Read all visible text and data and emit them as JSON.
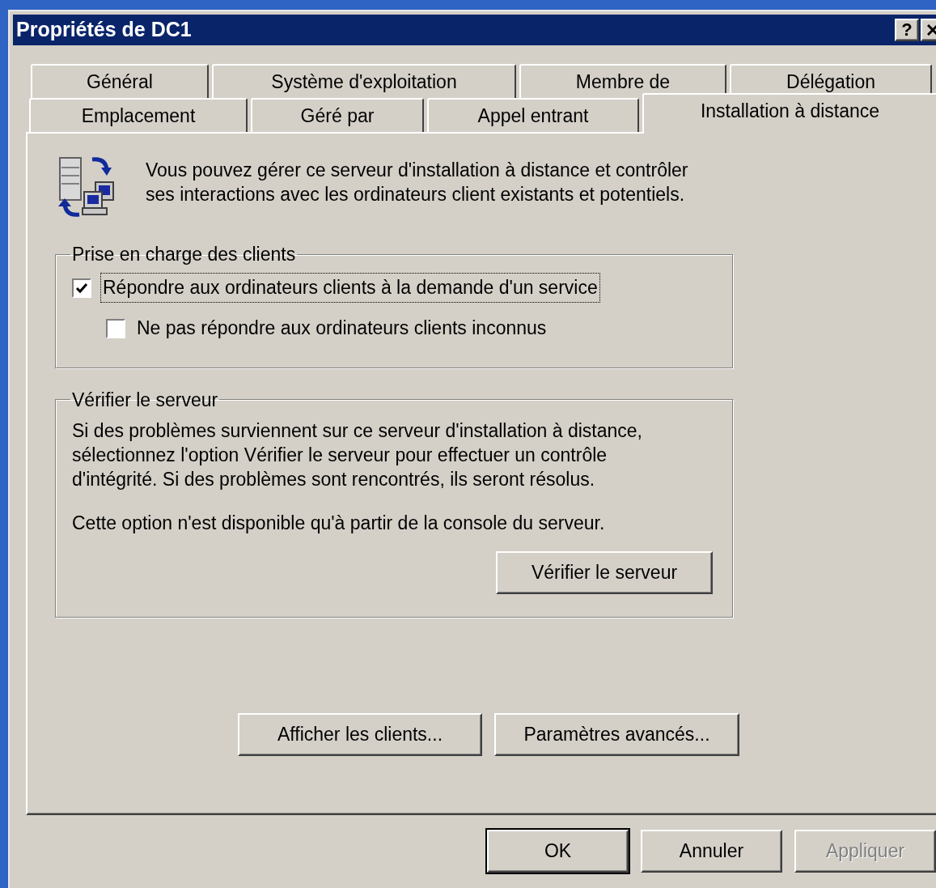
{
  "window": {
    "title": "Propriétés de DC1",
    "title_buttons": [
      {
        "kind": "help",
        "label": "?"
      },
      {
        "kind": "close"
      }
    ]
  },
  "tabs": [
    [
      {
        "label": "Général",
        "selected": false
      },
      {
        "label": "Système d'exploitation",
        "selected": false
      },
      {
        "label": "Membre de",
        "selected": false
      },
      {
        "label": "Délégation",
        "selected": false
      }
    ],
    [
      {
        "label": "Emplacement",
        "selected": false
      },
      {
        "label": "Géré par",
        "selected": false
      },
      {
        "label": "Appel entrant",
        "selected": false
      },
      {
        "label": "Installation à distance",
        "selected": true
      }
    ]
  ],
  "intro": [
    "Vous pouvez gérer ce serveur d'installation à distance et contrôler",
    "ses interactions avec les ordinateurs client existants et potentiels."
  ],
  "groups": [
    {
      "kind": "options",
      "title": "Prise en charge des clients",
      "options": [
        {
          "label": "Répondre aux ordinateurs clients à la demande d'un service",
          "checked": true,
          "focused": true,
          "children": [
            {
              "label": "Ne pas répondre aux ordinateurs clients inconnus",
              "checked": false,
              "focused": false
            }
          ]
        }
      ]
    },
    {
      "kind": "text",
      "title": "Vérifier le serveur",
      "paragraphs": [
        [
          "Si des problèmes surviennent sur ce serveur d'installation à distance,",
          "sélectionnez l'option Vérifier le serveur pour effectuer un contrôle",
          "d'intégrité. Si des problèmes sont rencontrés, ils seront résolus."
        ],
        [
          "Cette option n'est disponible qu'à partir de la console du serveur."
        ]
      ],
      "button": "Vérifier le serveur"
    }
  ],
  "action_buttons": [
    "Afficher les clients...",
    "Paramètres avancés..."
  ],
  "dialog_buttons": [
    {
      "label": "OK",
      "default": true,
      "disabled": false
    },
    {
      "label": "Annuler",
      "default": false,
      "disabled": false
    },
    {
      "label": "Appliquer",
      "default": false,
      "disabled": true
    }
  ]
}
